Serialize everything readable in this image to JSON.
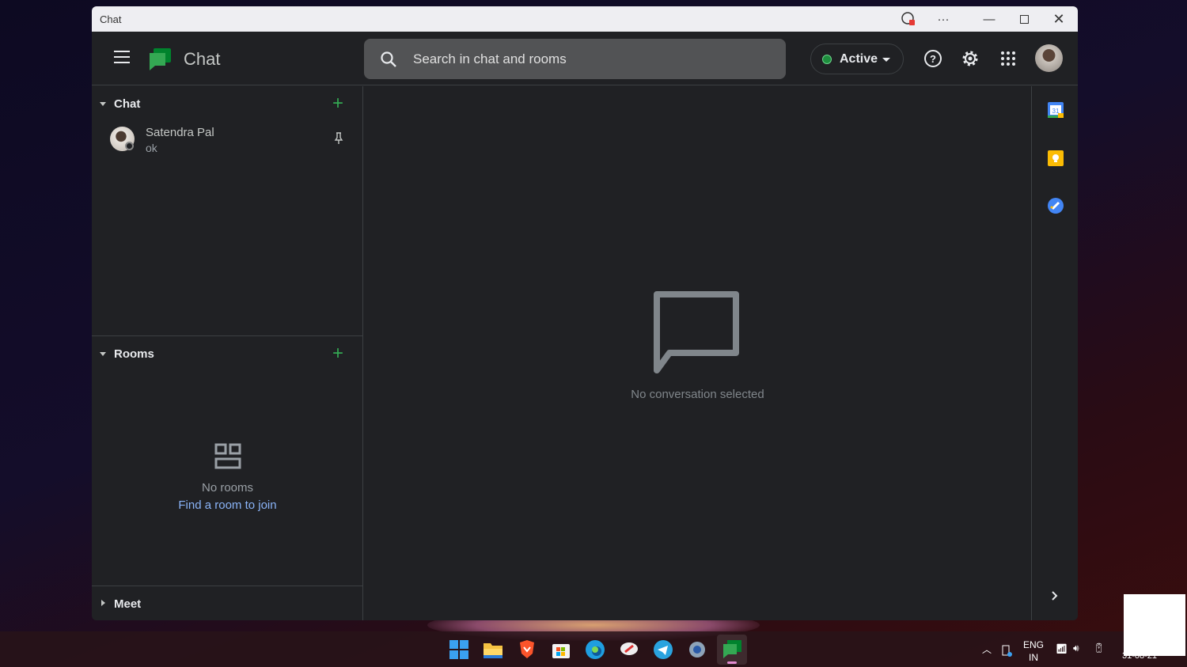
{
  "window": {
    "title": "Chat"
  },
  "header": {
    "app_title": "Chat",
    "search_placeholder": "Search in chat and rooms",
    "status": "Active",
    "status_color": "#1e8e3e"
  },
  "chat_section": {
    "label": "Chat",
    "conversations": [
      {
        "name": "Satendra Pal",
        "last_message": "ok",
        "pinned": true
      }
    ]
  },
  "rooms_section": {
    "label": "Rooms",
    "empty_text": "No rooms",
    "find_link": "Find a room to join"
  },
  "meet_section": {
    "label": "Meet"
  },
  "main": {
    "empty_text": "No conversation selected"
  },
  "side_panel": {
    "apps": [
      "calendar-icon",
      "keep-icon",
      "tasks-icon"
    ]
  },
  "taskbar": {
    "apps": [
      "start",
      "file-explorer",
      "brave",
      "microsoft-store",
      "edge",
      "app",
      "telegram",
      "settings",
      "google-chat"
    ],
    "lang_top": "ENG",
    "lang_bottom": "IN",
    "date": "31-08-21"
  },
  "colors": {
    "accent": "#34a853",
    "link": "#8ab4f8"
  }
}
